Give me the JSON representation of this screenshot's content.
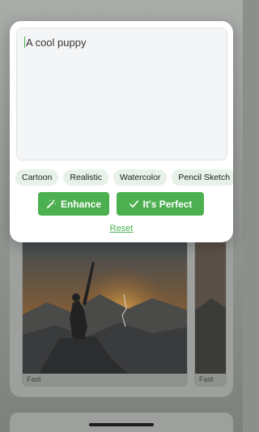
{
  "prompt": {
    "value": "A cool puppy"
  },
  "styles": [
    "Cartoon",
    "Realistic",
    "Watercolor",
    "Pencil Sketch"
  ],
  "actions": {
    "enhance_label": "Enhance",
    "perfect_label": "It's Perfect",
    "reset_label": "Reset"
  },
  "results": [
    {
      "speed": "Fast"
    },
    {
      "speed": "Fast"
    }
  ],
  "colors": {
    "accent": "#4caf50",
    "chip_bg": "#e7f1e7",
    "scrim": "#8c8f8c"
  },
  "icons": {
    "enhance": "magic-wand-icon",
    "perfect": "check-icon"
  }
}
